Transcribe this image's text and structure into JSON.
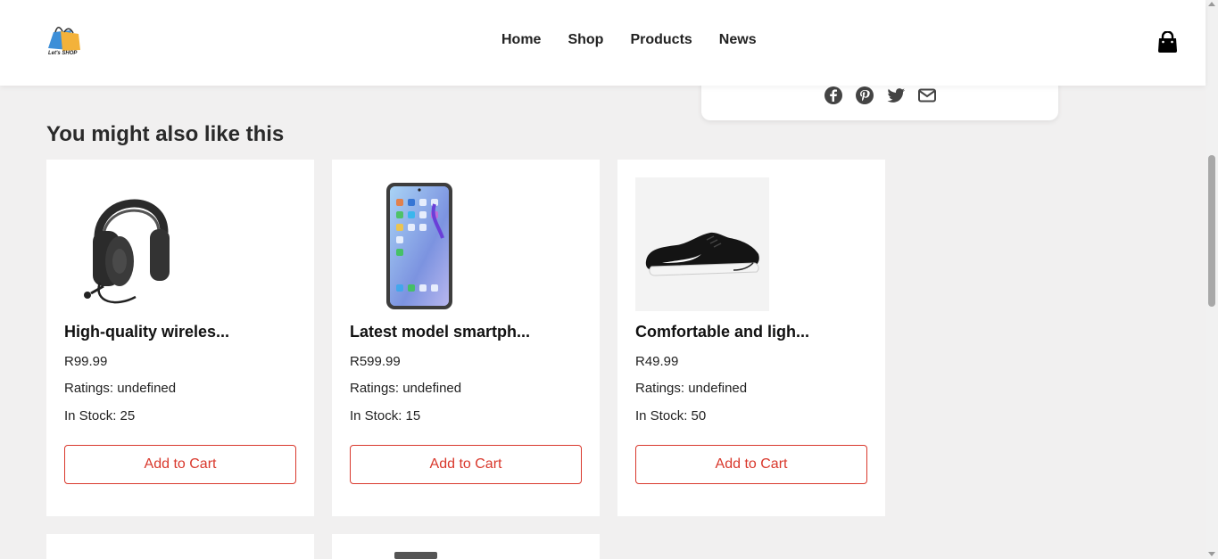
{
  "header": {
    "logo_text": "Let's SHOP",
    "nav": [
      "Home",
      "Shop",
      "Products",
      "News"
    ],
    "cart_icon": "shopping-bag-icon"
  },
  "share": {
    "icons": [
      "facebook-icon",
      "pinterest-icon",
      "twitter-icon",
      "envelope-icon"
    ]
  },
  "section": {
    "title": "You might also like this"
  },
  "products": [
    {
      "name": "High-quality wireles...",
      "price": "R99.99",
      "rating": "Ratings: undefined",
      "stock": "In Stock: 25",
      "button": "Add to Cart",
      "image": "headphones"
    },
    {
      "name": "Latest model smartph...",
      "price": "R599.99",
      "rating": "Ratings: undefined",
      "stock": "In Stock: 15",
      "button": "Add to Cart",
      "image": "smartphone"
    },
    {
      "name": "Comfortable and ligh...",
      "price": "R49.99",
      "rating": "Ratings: undefined",
      "stock": "In Stock: 50",
      "button": "Add to Cart",
      "image": "running-shoe"
    }
  ],
  "colors": {
    "accent": "#d9382c",
    "background": "#f1f0f0",
    "card": "#ffffff"
  }
}
